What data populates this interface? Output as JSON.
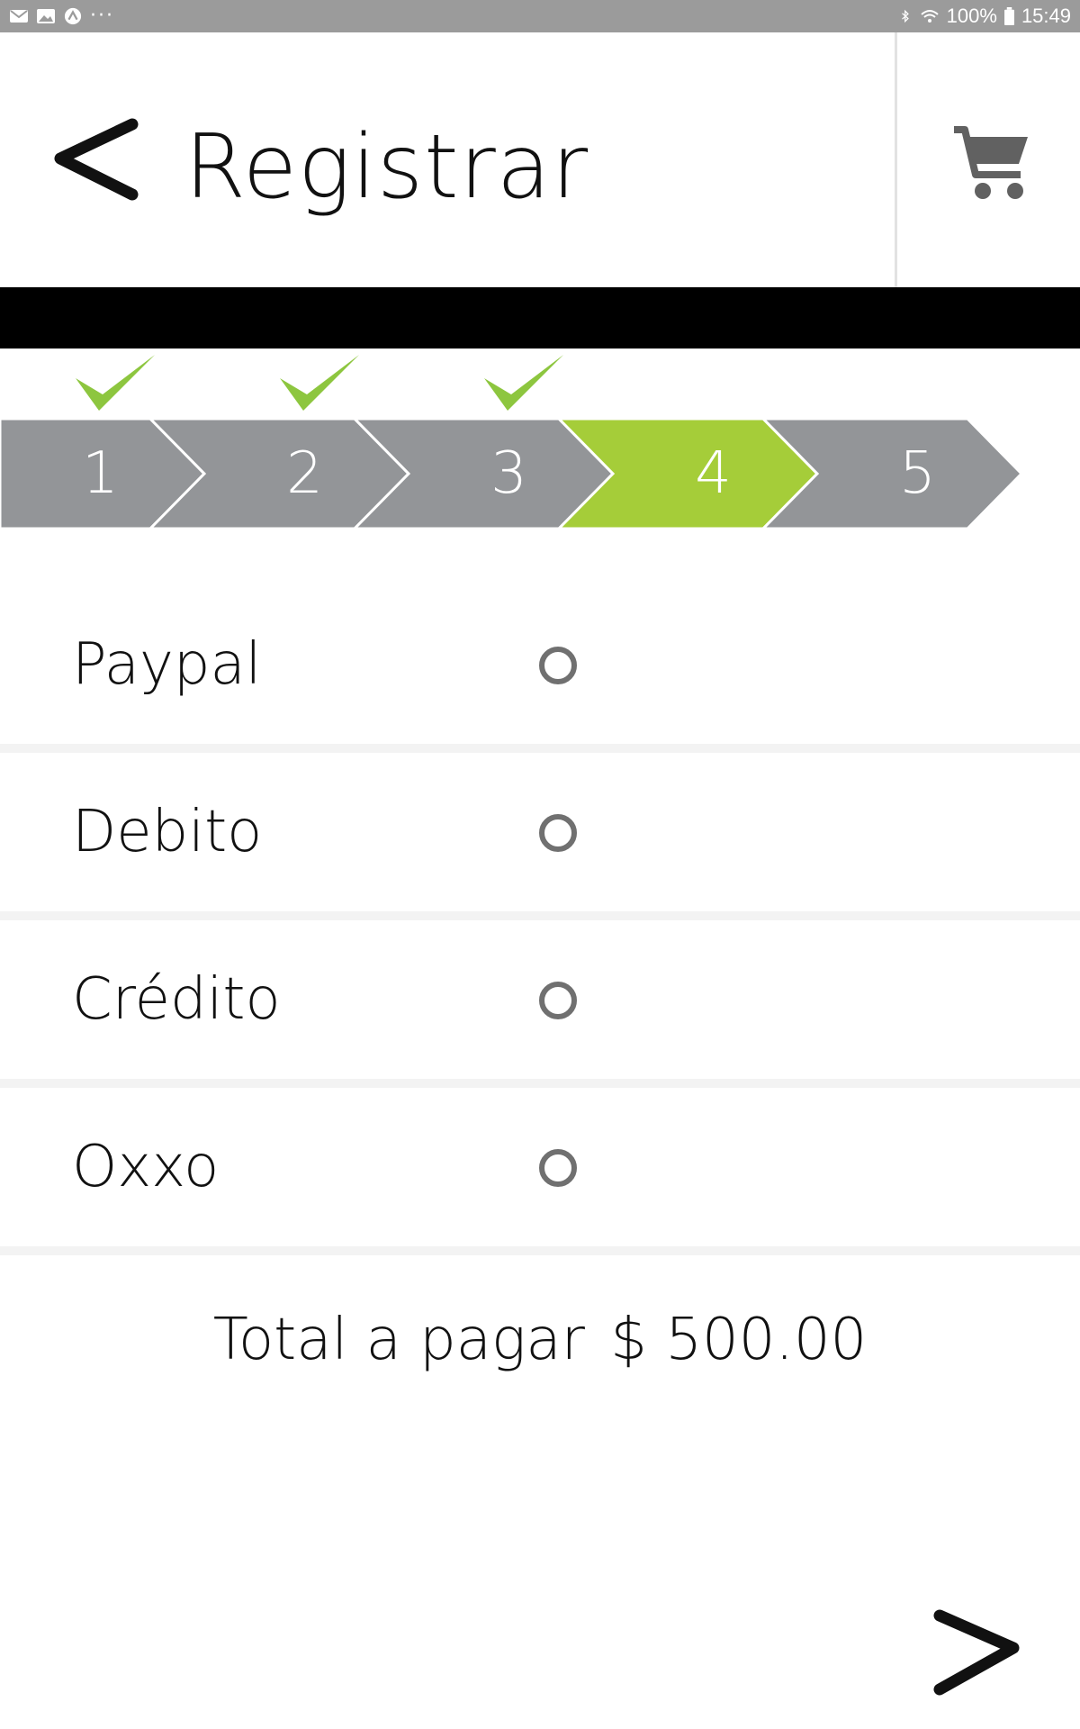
{
  "status_bar": {
    "left_icons": [
      "gmail-icon",
      "gallery-icon",
      "app-icon",
      "more-dots-icon"
    ],
    "more_text": "···",
    "bluetooth_icon": "bluetooth-icon",
    "wifi_icon": "wifi-icon",
    "battery_percent": "100%",
    "battery_icon": "battery-icon",
    "time": "15:49"
  },
  "header": {
    "back_icon": "chevron-left-icon",
    "title": "Registrar",
    "cart_icon": "shopping-cart-icon"
  },
  "stepper": {
    "steps": [
      {
        "label": "1",
        "completed": true
      },
      {
        "label": "2",
        "completed": true
      },
      {
        "label": "3",
        "completed": true
      },
      {
        "label": "4",
        "completed": false,
        "active": true
      },
      {
        "label": "5",
        "completed": false
      }
    ],
    "active_color": "#a5cd39",
    "inactive_color": "#939598",
    "check_color": "#8dc63f"
  },
  "payment_methods": [
    {
      "label": "Paypal",
      "selected": false
    },
    {
      "label": "Debito",
      "selected": false
    },
    {
      "label": "Crédito",
      "selected": false
    },
    {
      "label": "Oxxo",
      "selected": false
    }
  ],
  "total": {
    "label": "Total a pagar",
    "amount": "$ 500.00"
  },
  "footer": {
    "next_icon": "chevron-right-icon"
  }
}
